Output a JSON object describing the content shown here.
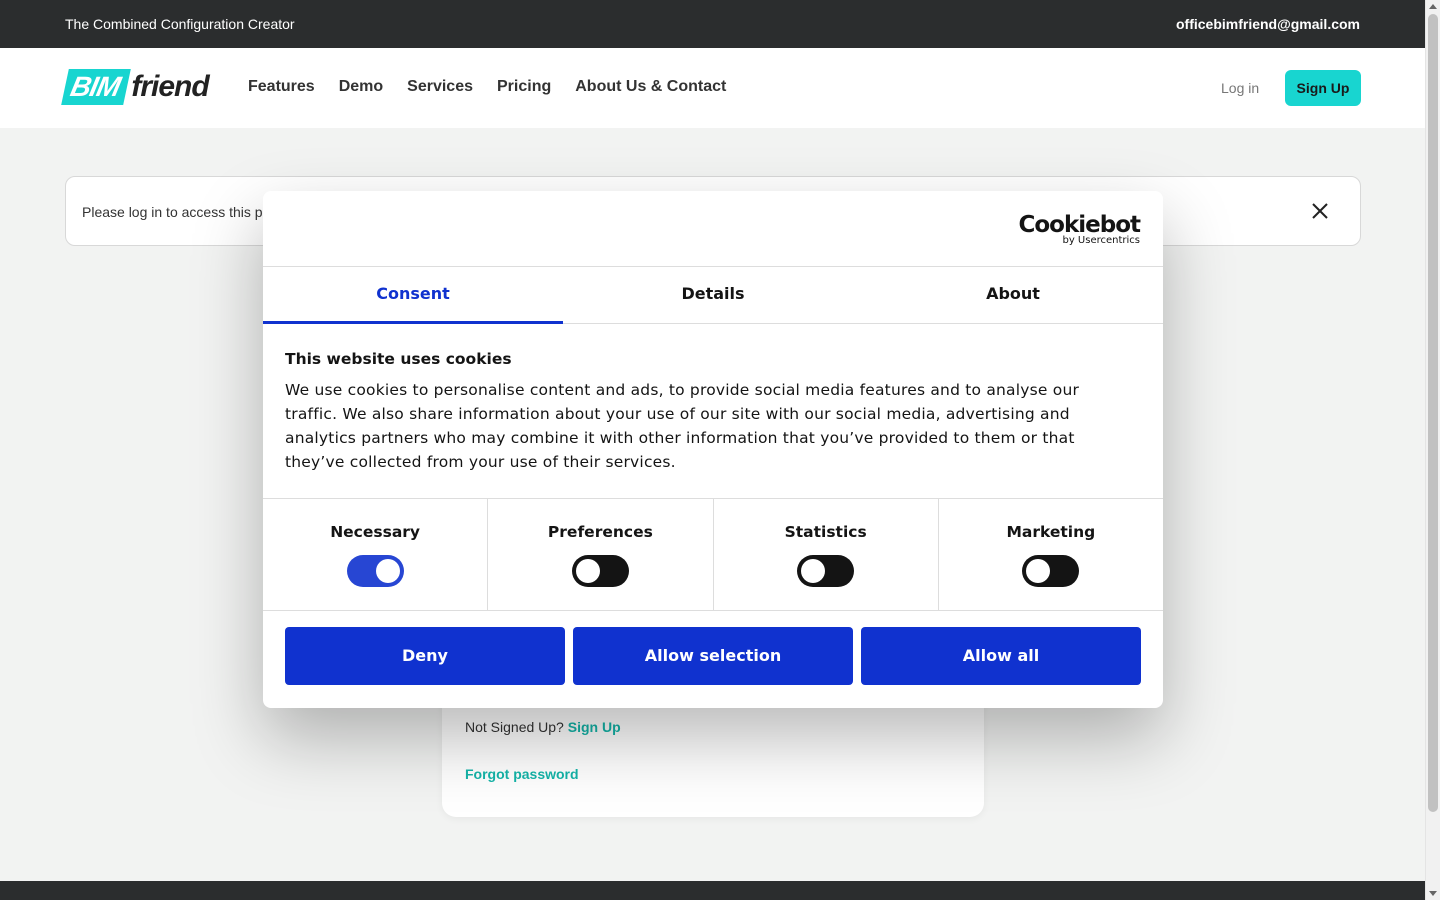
{
  "topbar": {
    "tagline": "The Combined Configuration Creator",
    "email": "officebimfriend@gmail.com"
  },
  "navbar": {
    "logo_left": "BIM",
    "logo_right": "friend",
    "links": [
      "Features",
      "Demo",
      "Services",
      "Pricing",
      "About Us & Contact"
    ],
    "login": "Log in",
    "signup": "Sign Up"
  },
  "alert": {
    "message": "Please log in to access this pa"
  },
  "login_card": {
    "not_signed_up": "Not Signed Up?",
    "signup_link": "Sign Up",
    "forgot_password": "Forgot password"
  },
  "cookie_dialog": {
    "brand": "Cookiebot",
    "brand_sub": "by Usercentrics",
    "tabs": [
      "Consent",
      "Details",
      "About"
    ],
    "active_tab": "Consent",
    "title": "This website uses cookies",
    "text": "We use cookies to personalise content and ads, to provide social media features and to analyse our traffic. We also share information about your use of our site with our social media, advertising and analytics partners who may combine it with other information that you’ve provided to them or that they’ve collected from your use of their services.",
    "categories": [
      {
        "label": "Necessary",
        "enabled": true
      },
      {
        "label": "Preferences",
        "enabled": false
      },
      {
        "label": "Statistics",
        "enabled": false
      },
      {
        "label": "Marketing",
        "enabled": false
      }
    ],
    "buttons": {
      "deny": "Deny",
      "allow_selection": "Allow selection",
      "allow_all": "Allow all"
    }
  },
  "colors": {
    "accent": "#18d5d0",
    "cookie_blue": "#1032cf",
    "dark_bar": "#2b2d2e",
    "page_bg": "#f2f3f2"
  }
}
